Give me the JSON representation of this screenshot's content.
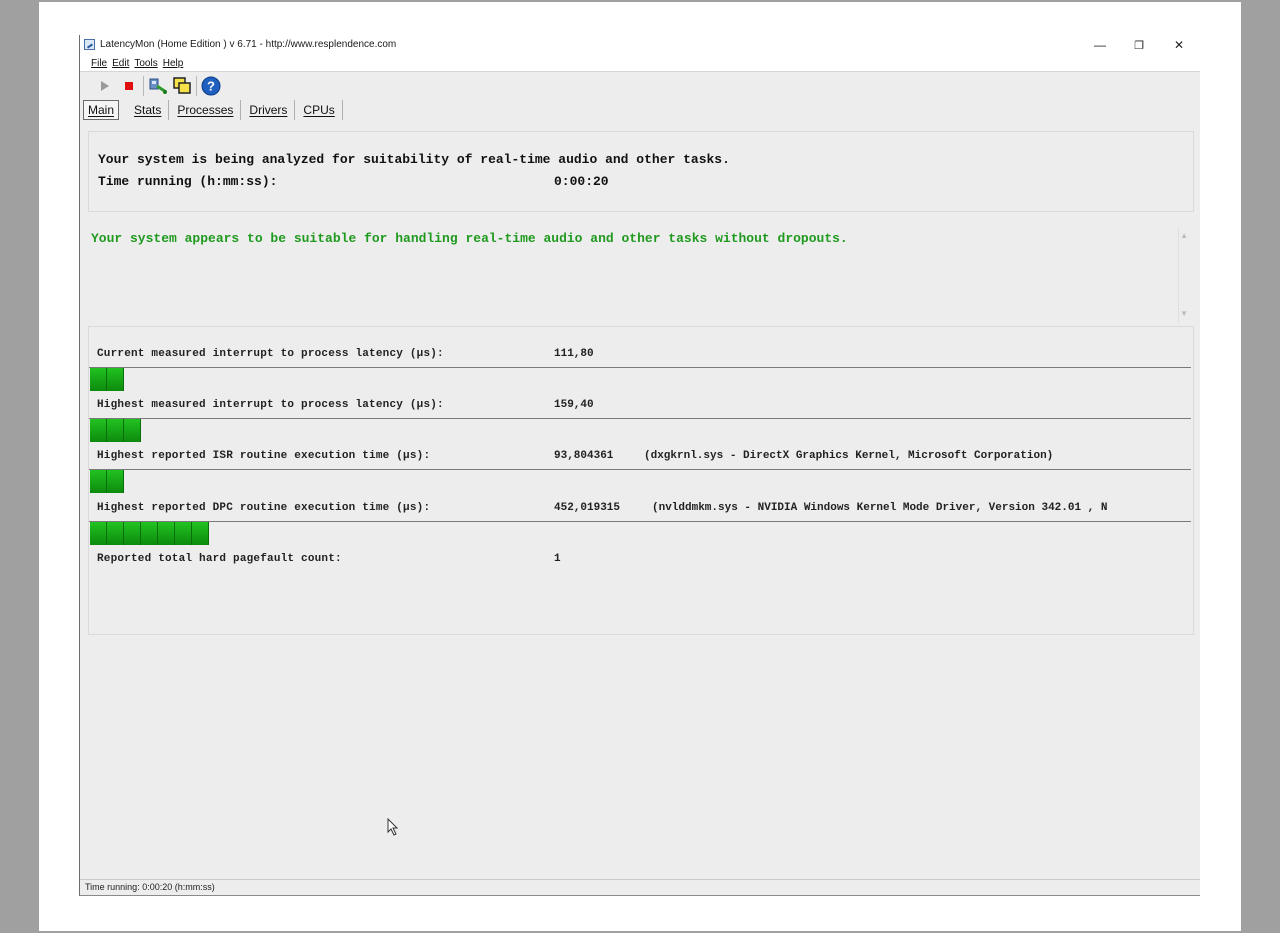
{
  "window": {
    "title": "LatencyMon  (Home Edition )  v 6.71 - http://www.resplendence.com",
    "controls": {
      "minimize": "—",
      "maximize": "❐",
      "close": "✕"
    }
  },
  "menu": {
    "items": [
      {
        "label": "File"
      },
      {
        "label": "Edit"
      },
      {
        "label": "Tools"
      },
      {
        "label": "Help"
      }
    ]
  },
  "toolbar": {
    "icons": [
      "start-icon",
      "stop-icon",
      "analyze-icon",
      "copy-icon",
      "help-icon"
    ],
    "colors": {
      "start": "#9a9a9a",
      "stop": "#e01010",
      "help": "#1f5fc0"
    }
  },
  "tabs": [
    {
      "label": "Main",
      "active": true
    },
    {
      "label": "Stats"
    },
    {
      "label": "Processes"
    },
    {
      "label": "Drivers"
    },
    {
      "label": "CPUs"
    }
  ],
  "summary": {
    "analyzing_text": "Your system is being analyzed for suitability of real-time audio and other tasks.",
    "time_label": "Time running (h:mm:ss):",
    "time_value": "0:00:20"
  },
  "verdict": {
    "text": "Your system appears to be suitable for handling real-time audio and other tasks without dropouts.",
    "color": "#1f9a1f"
  },
  "metrics": [
    {
      "label": "Current measured interrupt to process latency (µs):",
      "value": "111,80",
      "detail": "",
      "bar_segments": 2
    },
    {
      "label": "Highest measured interrupt to process latency (µs):",
      "value": "159,40",
      "detail": "",
      "bar_segments": 3
    },
    {
      "label": "Highest reported ISR routine execution time (µs):",
      "value": "93,804361",
      "detail": "(dxgkrnl.sys - DirectX Graphics Kernel, Microsoft Corporation)",
      "bar_segments": 2
    },
    {
      "label": "Highest reported DPC routine execution time (µs):",
      "value": "452,019315",
      "detail": "(nvlddmkm.sys - NVIDIA Windows Kernel Mode Driver, Version 342.01 , N",
      "bar_segments": 7
    }
  ],
  "pagefault": {
    "label": "Reported total hard pagefault count:",
    "value": "1"
  },
  "status_bar": {
    "text": "Time running: 0:00:20  (h:mm:ss)"
  }
}
